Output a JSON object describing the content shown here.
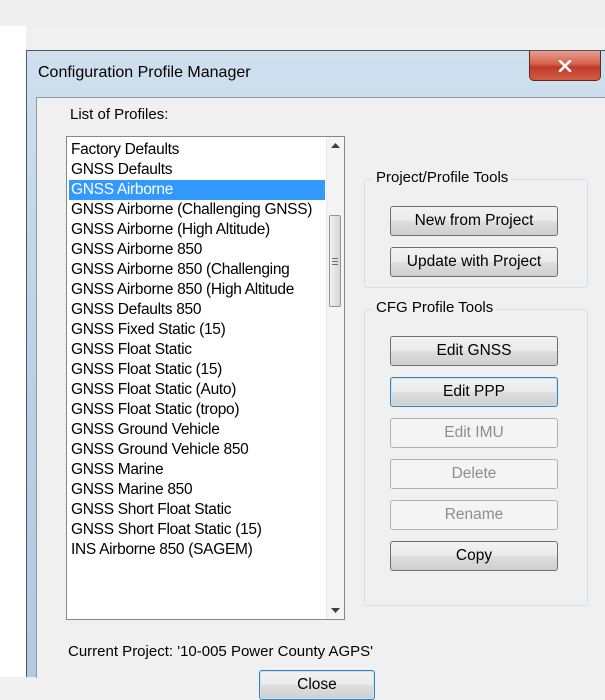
{
  "window": {
    "title": "Configuration Profile Manager",
    "close_icon": "close-x-icon"
  },
  "profiles": {
    "label": "List of Profiles:",
    "selected_index": 2,
    "items": [
      "Factory Defaults",
      "GNSS Defaults",
      "GNSS Airborne",
      "GNSS Airborne (Challenging GNSS)",
      "GNSS Airborne (High Altitude)",
      "GNSS Airborne 850",
      "GNSS Airborne 850 (Challenging",
      "GNSS Airborne 850 (High Altitude",
      "GNSS Defaults 850",
      "GNSS Fixed Static (15)",
      "GNSS Float Static",
      "GNSS Float Static (15)",
      "GNSS Float Static (Auto)",
      "GNSS Float Static (tropo)",
      "GNSS Ground Vehicle",
      "GNSS Ground Vehicle 850",
      "GNSS Marine",
      "GNSS Marine 850",
      "GNSS Short Float Static",
      "GNSS Short Float Static (15)",
      "INS Airborne 850 (SAGEM)"
    ]
  },
  "project_tools": {
    "title": "Project/Profile Tools",
    "new_label": "New from Project",
    "update_label": "Update with Project"
  },
  "cfg_tools": {
    "title": "CFG Profile Tools",
    "edit_gnss": "Edit GNSS",
    "edit_ppp": "Edit PPP",
    "edit_imu": "Edit IMU",
    "delete": "Delete",
    "rename": "Rename",
    "copy": "Copy"
  },
  "status": {
    "current_project": "Current Project: '10-005 Power County AGPS'"
  },
  "close_label": "Close"
}
